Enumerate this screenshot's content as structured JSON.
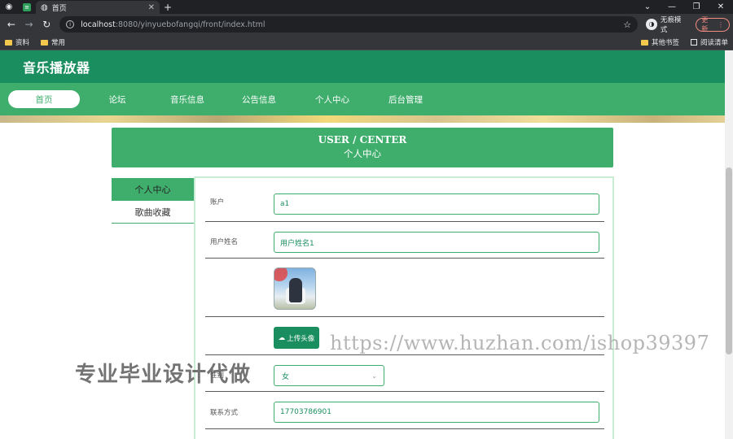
{
  "browser": {
    "tab_title": "首页",
    "url_host": "localhost",
    "url_path": ":8080/yinyuebofangqi/front/index.html",
    "incognito_label": "无痕模式",
    "update_label": "更新",
    "bookmarks": [
      "资料",
      "常用"
    ],
    "bookmarks_right": [
      "其他书签",
      "阅读清单"
    ]
  },
  "site": {
    "title": "音乐播放器",
    "nav": [
      {
        "label": "首页",
        "active": true
      },
      {
        "label": "论坛"
      },
      {
        "label": "音乐信息"
      },
      {
        "label": "公告信息"
      },
      {
        "label": "个人中心"
      },
      {
        "label": "后台管理"
      }
    ]
  },
  "center": {
    "title_en": "USER / CENTER",
    "title_zh": "个人中心"
  },
  "side_menu": [
    {
      "label": "个人中心",
      "active": true
    },
    {
      "label": "歌曲收藏"
    }
  ],
  "form": {
    "account": {
      "label": "账户",
      "value": "a1"
    },
    "username": {
      "label": "用户姓名",
      "value": "用户姓名1"
    },
    "upload_label": "上传头像",
    "gender": {
      "label": "性别",
      "value": "女"
    },
    "contact": {
      "label": "联系方式",
      "value": "17703786901"
    }
  },
  "watermarks": {
    "zh": "专业毕业设计代做",
    "url": "https://www.huzhan.com/ishop39397"
  },
  "colors": {
    "header_green": "#1a8e5e",
    "nav_green": "#3fae6d",
    "input_border": "#3fae6d"
  }
}
